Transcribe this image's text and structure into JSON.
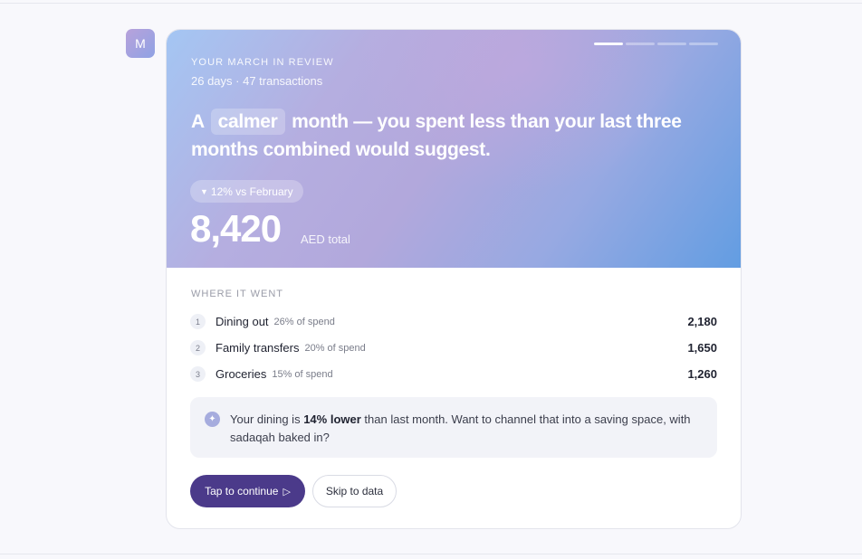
{
  "avatar": {
    "initial": "M"
  },
  "story_progress": {
    "total_segments": 4,
    "active_index": 0
  },
  "hero": {
    "eyebrow": "YOUR MARCH IN REVIEW",
    "subtitle": "26 days · 47 transactions",
    "headline": {
      "before": "A",
      "highlight": "calmer",
      "after": "month — you spent less than your last three months combined would suggest."
    },
    "delta": {
      "arrow": "▼",
      "text": "12% vs February"
    },
    "total": {
      "value": "8,420",
      "unit": "AED total"
    }
  },
  "breakdown": {
    "title": "WHERE IT WENT",
    "rows": [
      {
        "rank": "1",
        "category": "Dining out",
        "share": "26% of spend",
        "amount": "2,180"
      },
      {
        "rank": "2",
        "category": "Family transfers",
        "share": "20% of spend",
        "amount": "1,650"
      },
      {
        "rank": "3",
        "category": "Groceries",
        "share": "15% of spend",
        "amount": "1,260"
      }
    ]
  },
  "insight": {
    "icon": "sparkle-icon",
    "prefix": "Your dining is",
    "emphasis": "14% lower",
    "suffix": "than last month. Want to channel that into a saving space, with sadaqah baked in?"
  },
  "actions": {
    "primary_label": "Tap to continue",
    "primary_icon": "play-icon",
    "secondary_label": "Skip to data"
  },
  "colors": {
    "primary_button": "#4b3a8a",
    "hero_gradient_start": "#a4c6f3",
    "hero_gradient_mid": "#b2a8dc",
    "hero_gradient_end": "#629de2"
  }
}
